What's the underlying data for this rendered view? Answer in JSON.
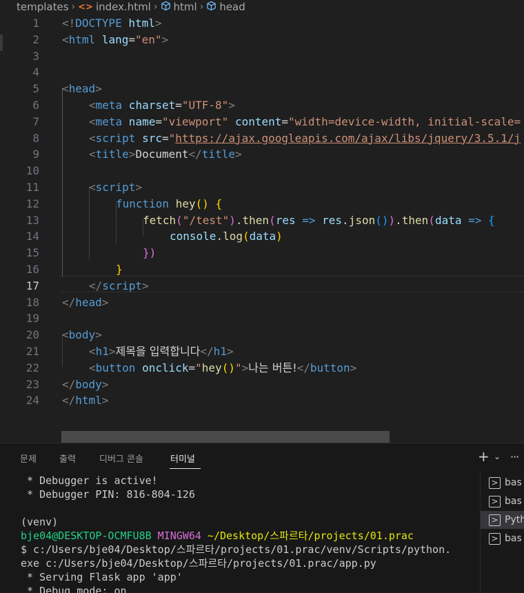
{
  "breadcrumb": {
    "items": [
      {
        "label": "templates",
        "icon": "none"
      },
      {
        "label": "index.html",
        "icon": "html-file-icon"
      },
      {
        "label": "html",
        "icon": "cube-icon"
      },
      {
        "label": "head",
        "icon": "cube-icon"
      }
    ],
    "separator": "›",
    "html_icon_text": "<>"
  },
  "editor": {
    "active_line": 17,
    "line_numbers": [
      "1",
      "2",
      "3",
      "4",
      "5",
      "6",
      "7",
      "8",
      "9",
      "10",
      "11",
      "12",
      "13",
      "14",
      "15",
      "16",
      "17",
      "18",
      "19",
      "20",
      "21",
      "22",
      "23",
      "24"
    ],
    "lines": {
      "l1": {
        "a": "<!",
        "b": "DOCTYPE",
        "c": " html",
        "d": ">"
      },
      "l2": {
        "a": "<",
        "b": "html",
        "c": " lang",
        "d": "=",
        "e": "\"en\"",
        "f": ">"
      },
      "l4": {
        "a": "<",
        "b": "head",
        "c": ">"
      },
      "l5": {
        "a": "<",
        "b": "meta",
        "c": " charset",
        "d": "=",
        "e": "\"UTF-8\"",
        "f": ">"
      },
      "l6": {
        "a": "<",
        "b": "meta",
        "c": " name",
        "d": "=",
        "e": "\"viewport\"",
        "f": " content",
        "g": "=",
        "h": "\"width=device-width, initial-scale="
      },
      "l7": {
        "a": "<",
        "b": "script",
        "c": " src",
        "d": "=",
        "e": "\"",
        "f": "https://ajax.googleapis.com/ajax/libs/jquery/3.5.1/j"
      },
      "l8": {
        "a": "<",
        "b": "title",
        "c": ">",
        "d": "Document",
        "e": "</",
        "f": "title",
        "g": ">"
      },
      "l10": {
        "a": "<",
        "b": "script",
        "c": ">"
      },
      "l11": {
        "a": "function",
        "b": " hey",
        "c": "()",
        "d": " {"
      },
      "l12": {
        "a": "fetch",
        "b": "(",
        "c": "\"/test\"",
        "d": ")",
        "e": ".",
        "f": "then",
        "g": "(",
        "h": "res",
        "i": " => ",
        "j": "res",
        "k": ".",
        "l": "json",
        "m": "()",
        "n": ")",
        "o": ".",
        "p": "then",
        "q": "(",
        "r": "data",
        "s": " => ",
        "t": "{"
      },
      "l13": {
        "a": "console",
        "b": ".",
        "c": "log",
        "d": "(",
        "e": "data",
        "f": ")"
      },
      "l14": {
        "a": "})"
      },
      "l15": {
        "a": "}"
      },
      "l16": {
        "a": "</",
        "b": "script",
        "c": ">"
      },
      "l17": {
        "a": "</",
        "b": "head",
        "c": ">"
      },
      "l19": {
        "a": "<",
        "b": "body",
        "c": ">"
      },
      "l20": {
        "a": "<",
        "b": "h1",
        "c": ">",
        "d": "제목을 입력합니다",
        "e": "</",
        "f": "h1",
        "g": ">"
      },
      "l21": {
        "a": "<",
        "b": "button",
        "c": " onclick",
        "d": "=",
        "e": "\"",
        "f": "hey",
        "g": "()",
        "h": "\"",
        "i": ">",
        "j": "나는 버튼!",
        "k": "</",
        "l": "button",
        "m": ">"
      },
      "l22": {
        "a": "</",
        "b": "body",
        "c": ">"
      },
      "l24": {
        "a": "</",
        "b": "html",
        "c": ">"
      }
    }
  },
  "panel": {
    "tabs": [
      "문제",
      "출력",
      "디버그 콘솔",
      "터미널"
    ],
    "active_tab": "터미널",
    "actions": {
      "plus": "+",
      "chevron": "⌄",
      "more": "···"
    }
  },
  "terminal": {
    "lines": [
      " * Debugger is active!",
      " * Debugger PIN: 816-804-126",
      "",
      "(venv)",
      "",
      "$ c:/Users/bje04/Desktop/스파르타/projects/01.prac/venv/Scripts/python.",
      "exe c:/Users/bje04/Desktop/스파르타/projects/01.prac/app.py",
      " * Serving Flask app 'app'",
      " * Debug mode: on"
    ],
    "prompt": {
      "user": "bje04@DESKTOP-OCMFU8B",
      "shell": " MINGW64",
      "path": " ~/Desktop/스파르타/projects/01.prac"
    }
  },
  "terminal_list": {
    "items": [
      {
        "label": "bas",
        "active": false
      },
      {
        "label": "bas",
        "active": false
      },
      {
        "label": "Pyth",
        "active": true
      },
      {
        "label": "bas",
        "active": false
      }
    ],
    "glyph": ">"
  }
}
